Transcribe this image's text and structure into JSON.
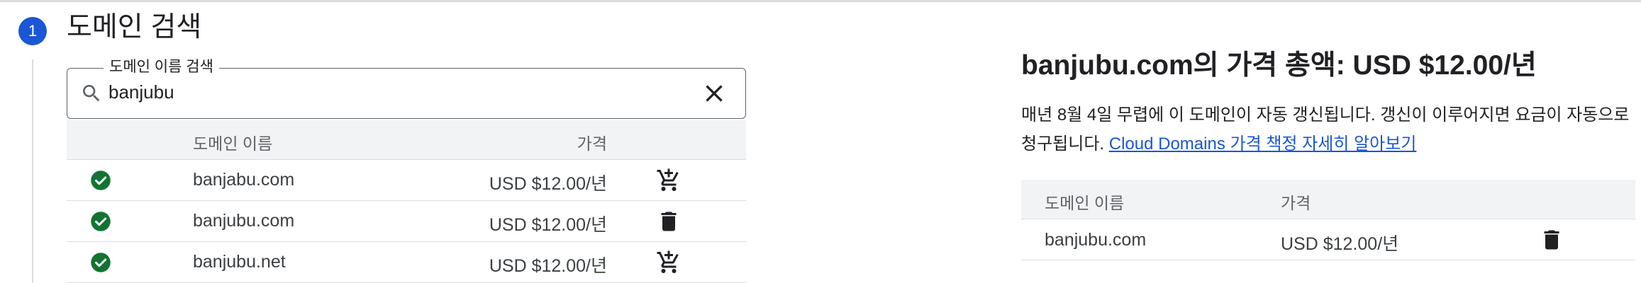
{
  "step": {
    "number": "1",
    "title": "도메인 검색"
  },
  "search": {
    "label": "도메인 이름 검색",
    "value": "banjubu",
    "icons": {
      "search": "search-icon",
      "clear": "close-icon"
    }
  },
  "results": {
    "columns": {
      "name": "도메인 이름",
      "price": "가격"
    },
    "rows": [
      {
        "name": "banjabu.com",
        "price": "USD $12.00/년",
        "available": true,
        "action": "add-to-cart"
      },
      {
        "name": "banjubu.com",
        "price": "USD $12.00/년",
        "available": true,
        "action": "remove"
      },
      {
        "name": "banjubu.net",
        "price": "USD $12.00/년",
        "available": true,
        "action": "add-to-cart"
      }
    ]
  },
  "summary": {
    "title": "banjubu.com의 가격 총액: USD $12.00/년",
    "description": "매년 8월 4일 무렵에 이 도메인이 자동 갱신됩니다. 갱신이 이루어지면 요금이 자동으로 청구됩니다.",
    "link": "Cloud Domains 가격 책정 자세히 알아보기",
    "columns": {
      "name": "도메인 이름",
      "price": "가격"
    },
    "rows": [
      {
        "name": "banjubu.com",
        "price": "USD $12.00/년",
        "action": "remove"
      }
    ]
  },
  "colors": {
    "accent": "#1a56d6",
    "available": "#137333",
    "header_bg": "#f1f3f4",
    "border": "#dadce0"
  }
}
